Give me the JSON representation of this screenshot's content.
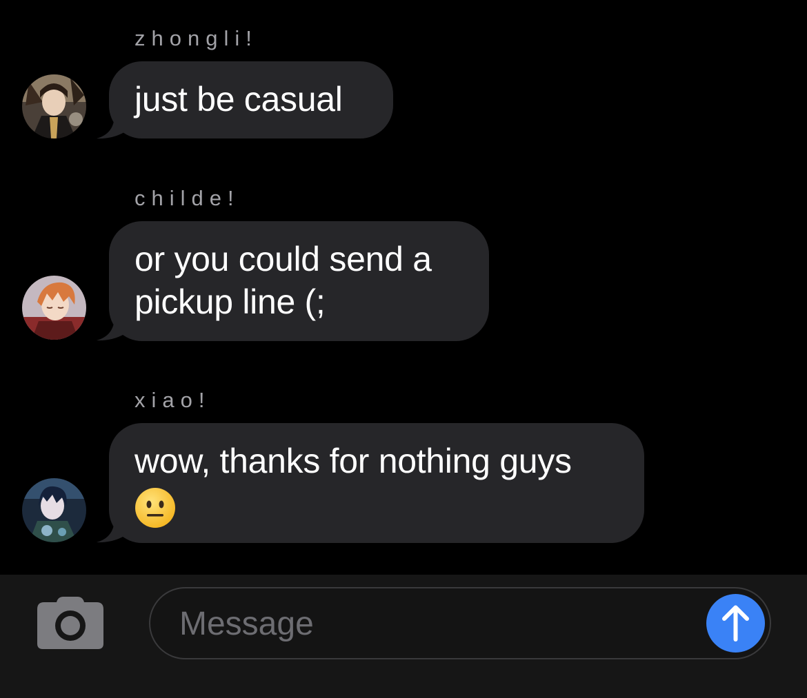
{
  "messages": [
    {
      "sender": "zhongli!",
      "text_lines": [
        "just be casual"
      ],
      "avatar_icon": "zhongli-avatar"
    },
    {
      "sender": "childe!",
      "text_lines": [
        "or you could send a",
        "pickup line (;"
      ],
      "avatar_icon": "childe-avatar"
    },
    {
      "sender": "xiao!",
      "text_lines": [
        "wow, thanks for nothing guys"
      ],
      "emoji": "neutral-face-emoji",
      "avatar_icon": "xiao-avatar"
    }
  ],
  "composer": {
    "placeholder": "Message",
    "value": "",
    "camera_icon": "camera-icon",
    "send_icon": "arrow-up-icon"
  },
  "colors": {
    "background": "#000000",
    "bubble": "#262629",
    "sender_name": "#a3a3a8",
    "composer_bar": "#161616",
    "send_button": "#3a82f6",
    "placeholder": "#6d6d72"
  }
}
